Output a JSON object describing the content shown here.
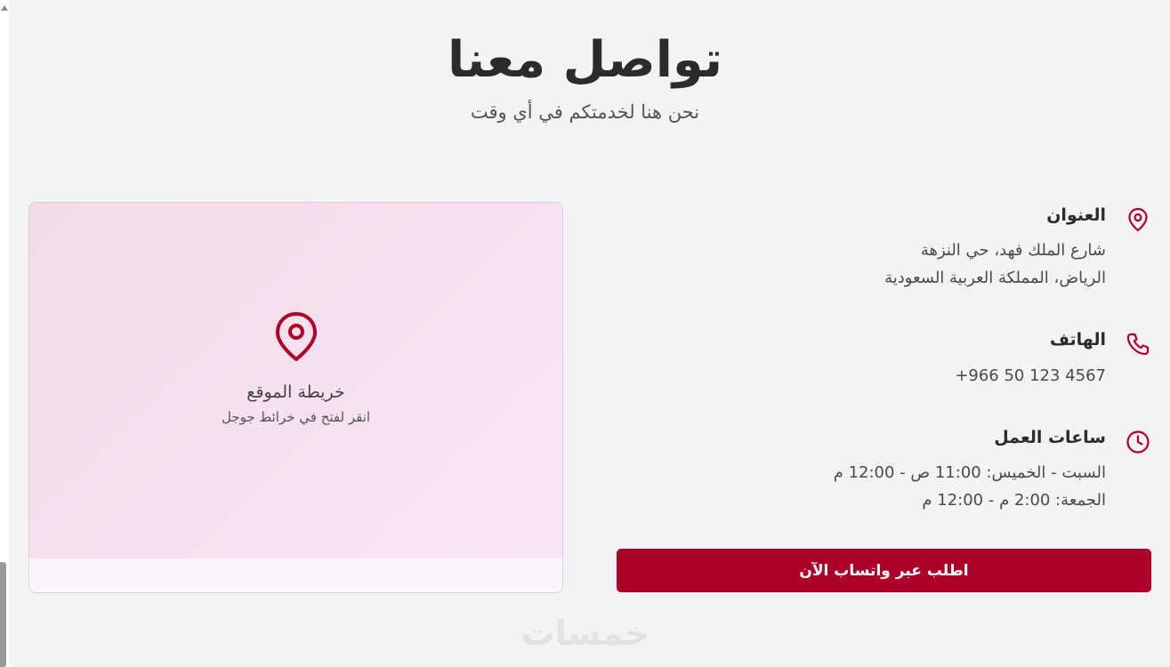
{
  "header": {
    "title": "تواصل معنا",
    "subtitle": "نحن هنا لخدمتكم في أي وقت"
  },
  "map": {
    "title": "خريطة الموقع",
    "hint": "انقر لفتح في خرائط جوجل",
    "icon": "location-pin-icon"
  },
  "contact": {
    "address": {
      "icon": "location-pin-icon",
      "label": "العنوان",
      "line1": "شارع الملك فهد، حي النزهة",
      "line2": "الرياض، المملكة العربية السعودية"
    },
    "phone": {
      "icon": "phone-icon",
      "label": "الهاتف",
      "number": "+966 50 123 4567"
    },
    "hours": {
      "icon": "clock-icon",
      "label": "ساعات العمل",
      "line1": "السبت - الخميس: 11:00 ص - 12:00 م",
      "line2": "الجمعة: 2:00 م - 12:00 م"
    }
  },
  "cta": {
    "whatsapp_label": "اطلب عبر واتساب الآن"
  },
  "watermark": "خمسات",
  "colors": {
    "accent": "#ad0029",
    "background": "#f4f2f5",
    "map_tint": "#f7e1f0"
  }
}
